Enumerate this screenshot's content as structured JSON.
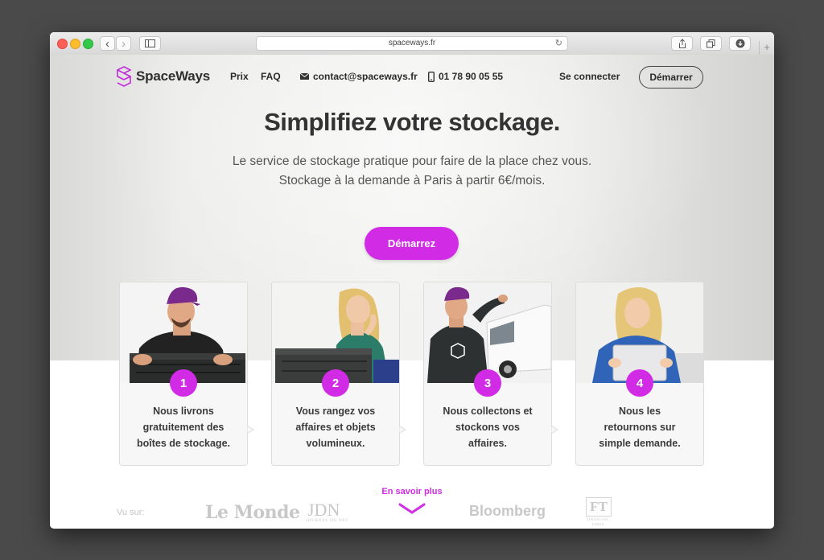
{
  "browser": {
    "url": "spaceways.fr",
    "back": "‹",
    "forward": "›",
    "reload": "↻",
    "new_tab": "+"
  },
  "header": {
    "brand": "SpaceWays",
    "nav": [
      "Prix",
      "FAQ"
    ],
    "email": "contact@spaceways.fr",
    "phone": "01 78 90 05 55",
    "login": "Se connecter",
    "start": "Démarrer"
  },
  "hero": {
    "title": "Simplifiez votre stockage.",
    "subtitle_line1": "Le service de stockage pratique pour faire de la place chez vous.",
    "subtitle_line2": "Stockage à la demande à Paris à partir 6€/mois.",
    "cta": "Démarrez"
  },
  "steps": [
    {
      "number": "1",
      "line1": "Nous livrons",
      "line2": "gratuitement des",
      "line3": "boîtes de stockage."
    },
    {
      "number": "2",
      "line1": "Vous rangez vos",
      "line2": "affaires et objets",
      "line3": "volumineux."
    },
    {
      "number": "3",
      "line1": "Nous collectons et",
      "line2": "stockons vos",
      "line3": "affaires."
    },
    {
      "number": "4",
      "line1": "Nous les",
      "line2": "retournons sur",
      "line3": "simple demande."
    }
  ],
  "more": "En savoir plus",
  "press": {
    "label": "Vu sur:",
    "logos": [
      "Le Monde",
      "JDN",
      "JOURNAL DU NET",
      "Bloomberg",
      "FT",
      "FINANCIAL",
      "TIMES"
    ]
  },
  "colors": {
    "accent": "#d12be6",
    "text": "#333333"
  }
}
